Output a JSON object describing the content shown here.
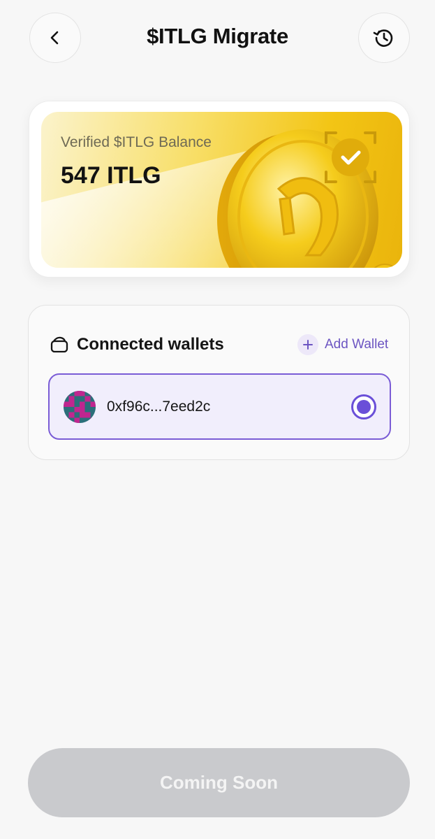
{
  "header": {
    "title": "$ITLG Migrate",
    "back_icon": "chevron-left-icon",
    "history_icon": "history-icon"
  },
  "balance": {
    "label": "Verified $ITLG Balance",
    "value": "547 ITLG",
    "coin_icon": "gold-coin-icon",
    "verified_icon": "check-badge-icon"
  },
  "wallets": {
    "title": "Connected wallets",
    "add_label": "Add Wallet",
    "items": [
      {
        "address": "0xf96c...7eed2c",
        "selected": true
      }
    ]
  },
  "footer": {
    "button_label": "Coming Soon"
  },
  "colors": {
    "accent": "#6a4fd8",
    "gold": "#f3c515",
    "disabled": "#c9cacd"
  }
}
